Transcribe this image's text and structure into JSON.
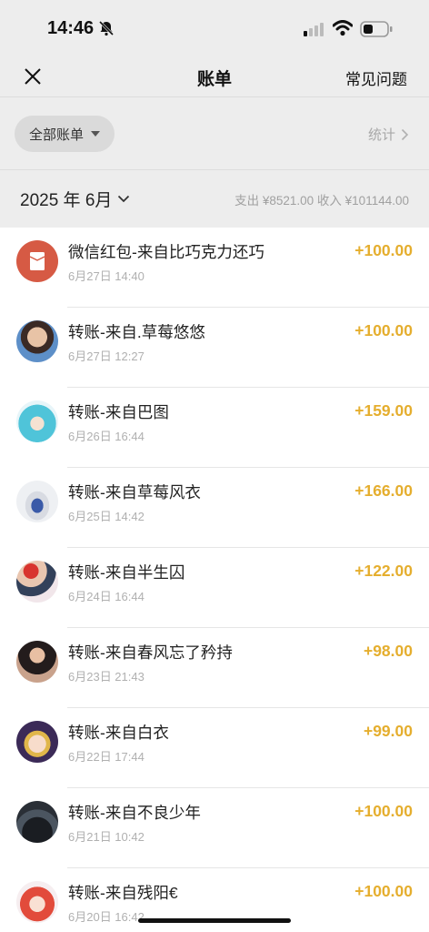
{
  "status": {
    "time": "14:46"
  },
  "nav": {
    "title": "账单",
    "faq": "常见问题"
  },
  "filter": {
    "chip_label": "全部账单",
    "stats_label": "统计"
  },
  "month": {
    "label": "2025 年 6月",
    "summary": "支出 ¥8521.00 收入 ¥101144.00"
  },
  "transactions": [
    {
      "title": "微信红包-来自比巧克力还巧",
      "time": "6月27日 14:40",
      "amount": "+100.00",
      "avatar": "red-packet"
    },
    {
      "title": "转账-来自.草莓悠悠",
      "time": "6月27日 12:27",
      "amount": "+100.00",
      "avatar": "user"
    },
    {
      "title": "转账-来自巴图",
      "time": "6月26日 16:44",
      "amount": "+159.00",
      "avatar": "user"
    },
    {
      "title": "转账-来自草莓风衣",
      "time": "6月25日 14:42",
      "amount": "+166.00",
      "avatar": "user"
    },
    {
      "title": "转账-来自半生囚",
      "time": "6月24日 16:44",
      "amount": "+122.00",
      "avatar": "user"
    },
    {
      "title": "转账-来自春风忘了矜持",
      "time": "6月23日 21:43",
      "amount": "+98.00",
      "avatar": "user"
    },
    {
      "title": "转账-来自白衣",
      "time": "6月22日 17:44",
      "amount": "+99.00",
      "avatar": "user"
    },
    {
      "title": "转账-来自不良少年",
      "time": "6月21日 10:42",
      "amount": "+100.00",
      "avatar": "user"
    },
    {
      "title": "转账-来自残阳€",
      "time": "6月20日 16:42",
      "amount": "+100.00",
      "avatar": "user"
    }
  ],
  "colors": {
    "amount": "#e5ae2e",
    "background": "#ededed",
    "red_packet": "#d65a44"
  }
}
